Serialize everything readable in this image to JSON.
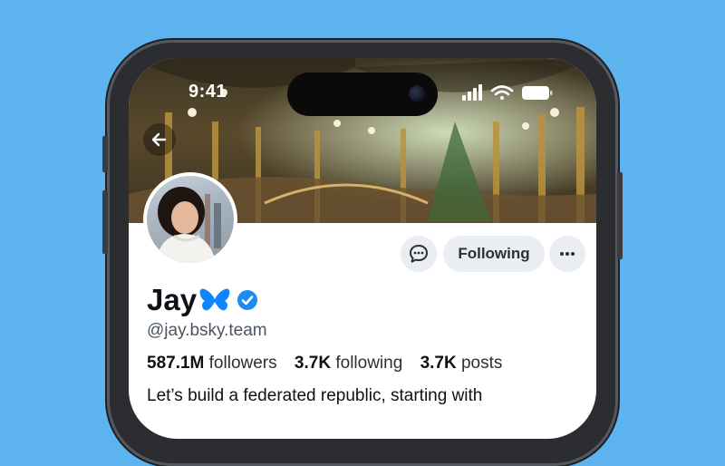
{
  "status_bar": {
    "time": "9:41"
  },
  "profile": {
    "display_name": "Jay",
    "handle": "@jay.bsky.team",
    "stats": [
      {
        "value": "587.1M",
        "label": "followers"
      },
      {
        "value": "3.7K",
        "label": "following"
      },
      {
        "value": "3.7K",
        "label": "posts"
      }
    ],
    "bio": "Let’s build a federated republic, starting with"
  },
  "actions": {
    "following_label": "Following"
  },
  "icons": {
    "back": "arrow-left-icon",
    "message": "chat-bubble-icon",
    "more": "ellipsis-icon",
    "verified": "verified-check-icon",
    "butterfly": "butterfly-icon"
  },
  "colors": {
    "background": "#5db4ef",
    "verified": "#1d8cf0",
    "butterfly": "#1185fe",
    "button_bg": "#eaeef2"
  }
}
